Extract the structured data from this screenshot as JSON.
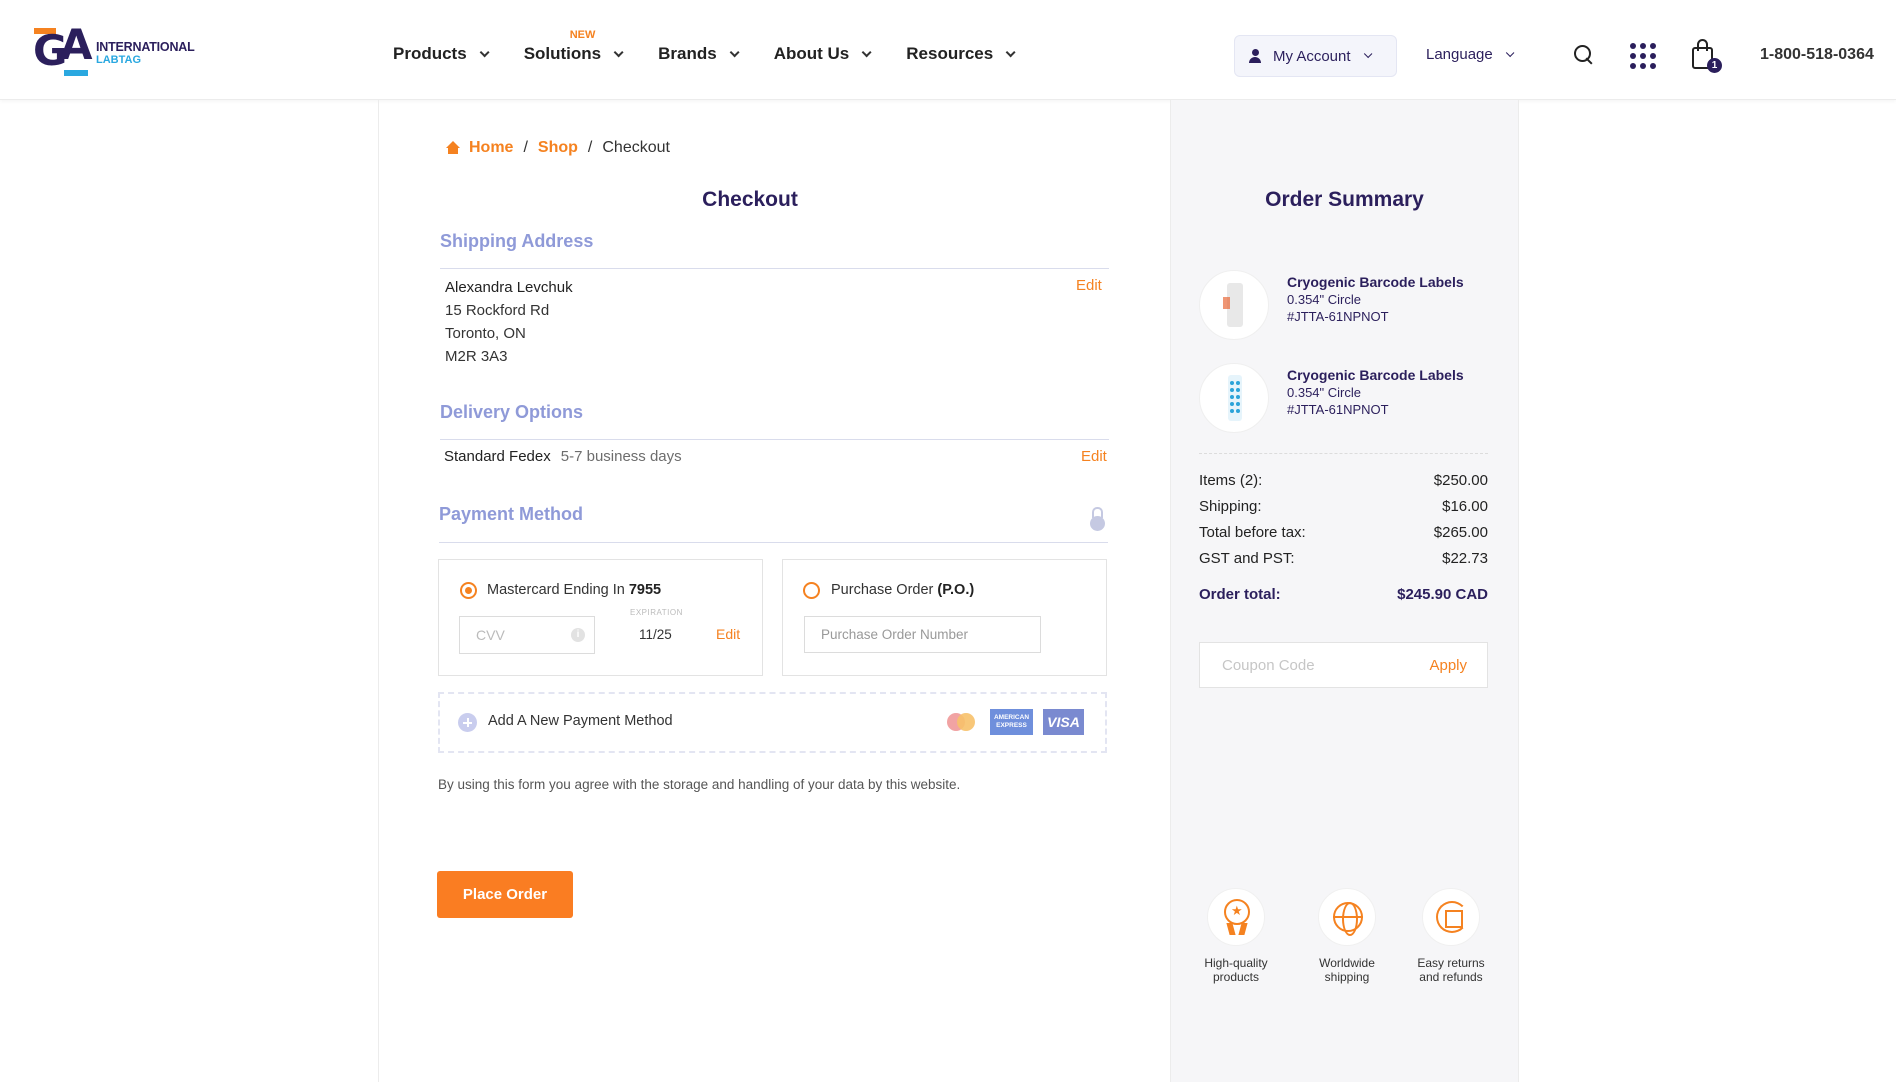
{
  "brand": {
    "line1": "INTERNATIONAL",
    "line2": "LABTAG"
  },
  "nav": {
    "items": [
      {
        "label": "Products"
      },
      {
        "label": "Solutions",
        "badge": "NEW"
      },
      {
        "label": "Brands"
      },
      {
        "label": "About Us"
      },
      {
        "label": "Resources"
      }
    ],
    "account_label": "My Account",
    "language_label": "Language",
    "cart_count": "1",
    "phone": "1-800-518-0364"
  },
  "breadcrumb": {
    "home": "Home",
    "shop": "Shop",
    "current": "Checkout"
  },
  "checkout": {
    "title": "Checkout",
    "shipping": {
      "title": "Shipping Address",
      "edit": "Edit",
      "name": "Alexandra Levchuk",
      "street": "15 Rockford Rd",
      "city": "Toronto, ON",
      "postal": "M2R 3A3"
    },
    "delivery": {
      "title": "Delivery Options",
      "edit": "Edit",
      "method": "Standard Fedex",
      "time": "5-7 business days"
    },
    "payment": {
      "title": "Payment Method",
      "card_label": "Mastercard Ending In",
      "card_last4": "7955",
      "cvv_placeholder": "CVV",
      "info": "i",
      "expiration_label": "EXPIRATION",
      "expiration": "11/25",
      "edit": "Edit",
      "po_label": "Purchase Order",
      "po_abbr": "(P.O.)",
      "po_placeholder": "Purchase Order Number",
      "add_new": "Add A New Payment Method",
      "amex_text": "AMERICAN EXPRESS",
      "visa_text": "VISA"
    },
    "consent": "By using this form you agree with the storage and handling of your data by this website.",
    "place_order": "Place Order"
  },
  "summary": {
    "title": "Order Summary",
    "products": [
      {
        "name": "Cryogenic Barcode Labels",
        "size": "0.354\" Circle",
        "sku": "#JTTA-61NPNOT"
      },
      {
        "name": "Cryogenic Barcode Labels",
        "size": "0.354\" Circle",
        "sku": "#JTTA-61NPNOT"
      }
    ],
    "totals": [
      {
        "label": "Items (2):",
        "value": "$250.00"
      },
      {
        "label": "Shipping:",
        "value": "$16.00"
      },
      {
        "label": "Total before tax:",
        "value": "$265.00"
      },
      {
        "label": "GST and PST:",
        "value": "$22.73"
      }
    ],
    "order_total_label": "Order total:",
    "order_total_value": "$245.90 CAD",
    "coupon_placeholder": "Coupon Code",
    "coupon_apply": "Apply",
    "features": [
      {
        "line1": "High-quality",
        "line2": "products"
      },
      {
        "line1": "Worldwide",
        "line2": "shipping"
      },
      {
        "line1": "Easy returns",
        "line2": "and refunds"
      }
    ]
  },
  "colors": {
    "navy": "#2b1f5c",
    "orange": "#f58220",
    "lavender": "#8f9ad8"
  }
}
